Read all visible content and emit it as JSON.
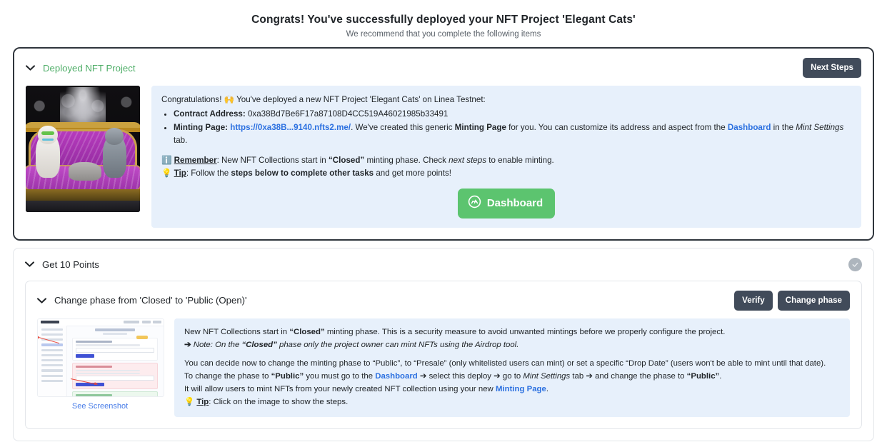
{
  "header": {
    "title": "Congrats! You've successfully deployed your NFT Project 'Elegant Cats'",
    "subtitle": "We recommend that you complete the following items"
  },
  "section_deployed": {
    "chevron": "⌄",
    "title": "Deployed NFT Project",
    "next_steps_label": "Next Steps",
    "thumbnail_alt": "Elegant Cats NFT artwork: three cats on a purple baroque sofa",
    "intro_before_emoji": "Congratulations! ",
    "intro_emoji": "🙌",
    "intro_after_emoji": " You've deployed a new NFT Project 'Elegant Cats' on Linea Testnet:",
    "bullet_contract_label": "Contract Address:",
    "bullet_contract_value": "0xa38Bd7Be6F17a87108D4CC519A46021985b33491",
    "bullet_minting_label": "Minting Page:",
    "bullet_minting_link": "https://0xa38B...9140.nfts2.me/",
    "bullet_minting_text_1": ". We've created this generic ",
    "bullet_minting_bold": "Minting Page",
    "bullet_minting_text_2": " for you. You can customize its address and aspect from the ",
    "bullet_minting_dashboard": "Dashboard",
    "bullet_minting_text_3": " in the ",
    "bullet_minting_italic": "Mint Settings",
    "bullet_minting_text_4": " tab.",
    "remember_emoji": "ℹ️",
    "remember_label": "Remember",
    "remember_text_1": ": New NFT Collections start in ",
    "remember_bold": "“Closed”",
    "remember_text_2": " minting phase. Check ",
    "remember_italic": "next steps",
    "remember_text_3": " to enable minting.",
    "tip_emoji": "💡",
    "tip_label": "Tip",
    "tip_text_1": ": Follow the ",
    "tip_bold": "steps below to complete other tasks",
    "tip_text_2": " and get more points!",
    "dashboard_button_label": "Dashboard",
    "dashboard_icon": "gauge-icon"
  },
  "section_points": {
    "chevron": "⌄",
    "title": "Get 10 Points",
    "status_icon": "check-circle-icon",
    "status_state": "incomplete",
    "status_color": "#adb5bd"
  },
  "section_phase": {
    "chevron": "⌄",
    "title": "Change phase from 'Closed' to 'Public (Open)'",
    "verify_label": "Verify",
    "change_phase_label": "Change phase",
    "screenshot_caption": "See Screenshot",
    "p1_text_1": "New NFT Collections start in ",
    "p1_bold": "“Closed”",
    "p1_text_2": " minting phase. This is a security measure to avoid unwanted mintings before we properly configure the project.",
    "p2_arrow": "➔",
    "p2_italic_1": " Note: On the ",
    "p2_bold": "“Closed”",
    "p2_italic_2": " phase only the project owner can mint NFTs using the Airdrop tool.",
    "p3": "You can decide now to change the minting phase to “Public”, to “Presale” (only whitelisted users can mint) or set a specific “Drop Date” (users won't be able to mint until that date).",
    "p4_text_1": "To change the phase to ",
    "p4_bold_1": "“Public”",
    "p4_text_2": " you must go to the ",
    "p4_link": "Dashboard",
    "p4_arrow_1": " ➔ ",
    "p4_text_3": "select this deploy",
    "p4_arrow_2": " ➔ ",
    "p4_text_4": "go to ",
    "p4_italic": "Mint Settings",
    "p4_text_5": " tab",
    "p4_arrow_3": " ➔ ",
    "p4_text_6": "and change the phase to ",
    "p4_bold_2": "“Public”",
    "p4_text_7": ".",
    "p5_text_1": "It will allow users to mint NFTs from your newly created NFT collection using your new ",
    "p5_link": "Minting Page",
    "p5_text_2": ".",
    "tip_emoji": "💡",
    "tip_label": "Tip",
    "tip_text": ": Click on the image to show the steps."
  },
  "colors": {
    "accent_green": "#5cc46f",
    "link_blue": "#2b70e0",
    "dark_button": "#414b5a",
    "callout_bg": "#e7f0fb",
    "border": "#e3e6ea"
  }
}
